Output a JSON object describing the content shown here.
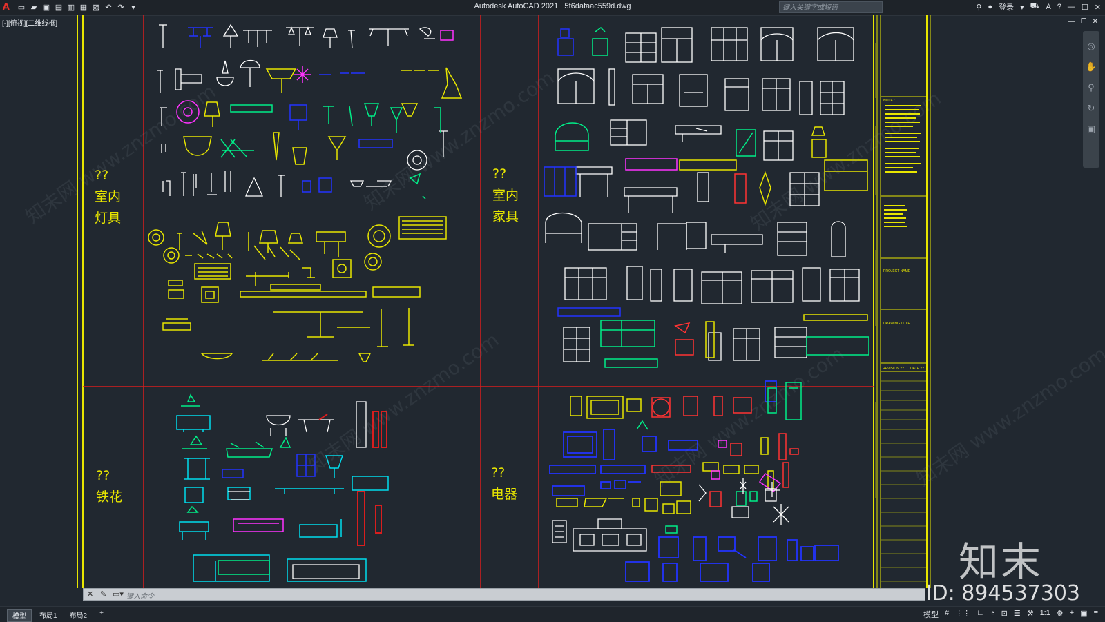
{
  "app": {
    "title": "Autodesk AutoCAD 2021",
    "filename": "5f6dafaac559d.dwg",
    "logo": "A",
    "search_placeholder": "键入关键字或短语",
    "login_label": "登录",
    "view_label": "[-][俯视][二维线框]",
    "qat_icons": [
      "new-icon",
      "open-icon",
      "save-icon",
      "saveas-icon",
      "publish-icon",
      "plot-icon",
      "print-icon",
      "undo-icon",
      "redo-icon",
      "customize-icon"
    ]
  },
  "drawing": {
    "colors": {
      "frame_yellow": "#e8e600",
      "divider_red": "#d81e1e",
      "bg": "#212830"
    },
    "sections": [
      {
        "label_lines": [
          "??",
          "室内",
          "灯具"
        ]
      },
      {
        "label_lines": [
          "??",
          "室内",
          "家具"
        ]
      },
      {
        "label_lines": [
          "??",
          "铁花"
        ]
      },
      {
        "label_lines": [
          "??",
          "电器"
        ]
      }
    ],
    "title_block": {
      "notes_label": "NOTE :",
      "project_name": "PROJECT NAME",
      "drawing_title": "DRAWING TITLE",
      "revision": "REVISION ??",
      "date": "DATE ??"
    }
  },
  "commandline": {
    "close": "✕",
    "prompt": "键入命令"
  },
  "statusbar": {
    "tabs": [
      "模型",
      "布局1",
      "布局2",
      "+"
    ],
    "model_label": "模型",
    "scale_label": "1:1"
  },
  "watermark": {
    "logo": "知末",
    "id": "ID: 894537303",
    "diagonal": "知末网 www.znzmo.com"
  }
}
